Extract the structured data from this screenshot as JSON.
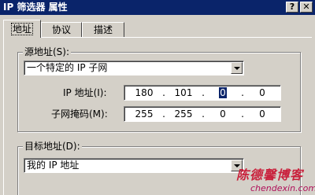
{
  "window": {
    "title": "IP 筛选器 属性",
    "help_btn": "?",
    "close_btn": "✕"
  },
  "tabs": [
    {
      "label": "地址",
      "active": true
    },
    {
      "label": "协议",
      "active": false
    },
    {
      "label": "描述",
      "active": false
    }
  ],
  "source": {
    "group_label": "源地址(S):",
    "selected": "一个特定的 IP 子网",
    "ip_label": "IP 地址(I):",
    "ip": [
      "180",
      "101",
      "0",
      "0"
    ],
    "mask_label": "子网掩码(M):",
    "mask": [
      "255",
      "255",
      "0",
      "0"
    ]
  },
  "destination": {
    "group_label": "目标地址(D):",
    "selected": "我的 IP 地址"
  },
  "watermark": {
    "title": "陈德馨博客",
    "url": "chendexin.com"
  },
  "colors": {
    "titlebar": "#0a246a",
    "face": "#d4d0c8",
    "watermark": "#c8102e"
  }
}
